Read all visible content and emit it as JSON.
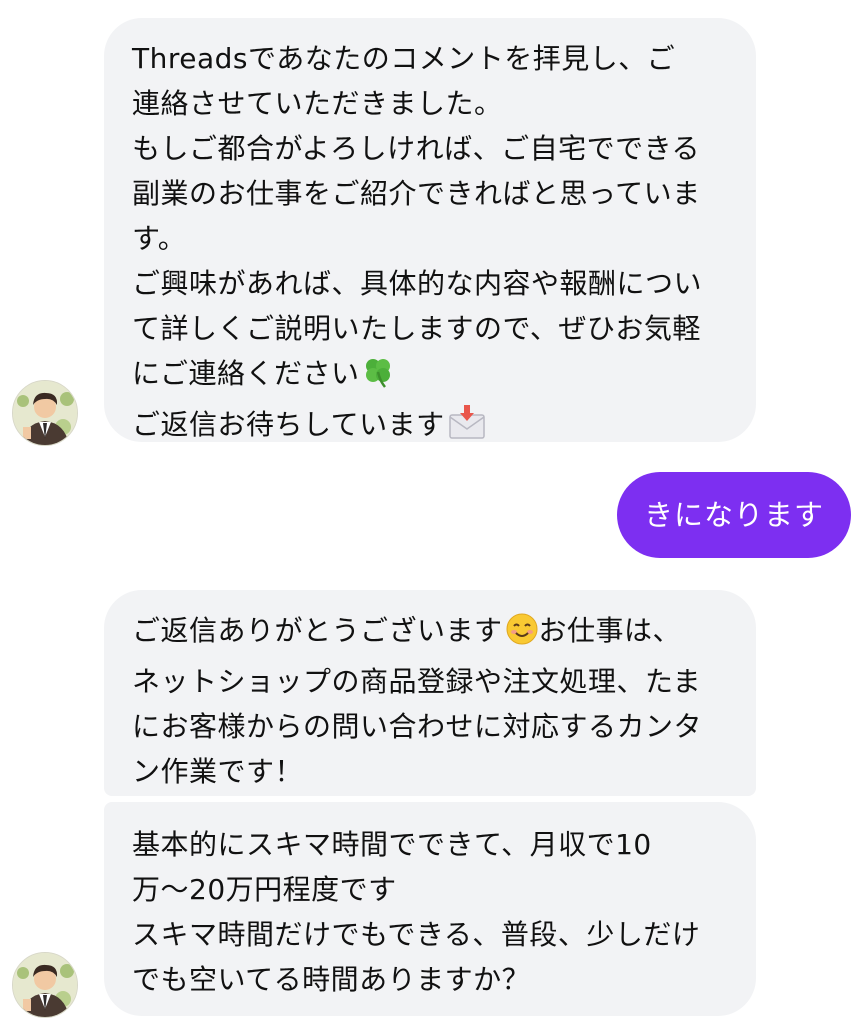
{
  "conversation": {
    "message1": {
      "lines": [
        "Threadsであなたのコメントを拝見し、ご",
        "連絡させていただきました。",
        "もしご都合がよろしければ、ご自宅でできる",
        "副業のお仕事をご紹介できればと思っていま",
        "す。",
        "ご興味があれば、具体的な内容や報酬につい",
        "て詳しくご説明いたしますので、ぜひお気軽",
        "にご連絡ください",
        "ご返信お待ちしています"
      ],
      "emojis": [
        "four-leaf-clover-icon",
        "inbox-envelope-icon"
      ]
    },
    "sent_message": "きになります",
    "message3": {
      "lines": [
        "ご返信ありがとうございます",
        "お仕事は、",
        "ネットショップの商品登録や注文処理、たま",
        "にお客様からの問い合わせに対応するカンタ",
        "ン作業です！"
      ],
      "emojis": [
        "smiling-face-icon"
      ]
    },
    "message4": {
      "lines": [
        "基本的にスキマ時間でできて、月収で10",
        "万〜20万円程度です",
        "スキマ時間だけでもできる、普段、少しだけ",
        "でも空いてる時間ありますか？"
      ]
    }
  },
  "colors": {
    "received_bubble": "#f2f3f5",
    "sent_bubble": "#7d2ff1",
    "sent_text": "#ffffff"
  },
  "icons": {
    "avatar": "businessman-avatar-icon"
  }
}
